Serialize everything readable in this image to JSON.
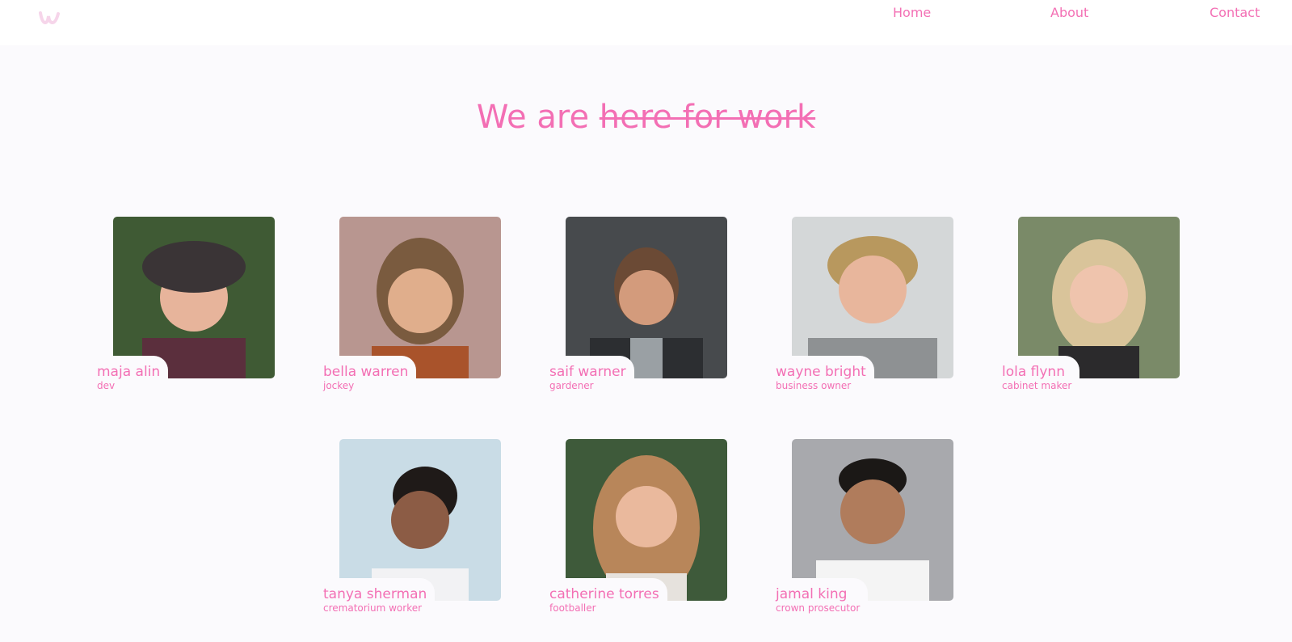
{
  "nav": {
    "logo_icon": "w-logo-icon",
    "links": [
      "Home",
      "About",
      "Contact"
    ]
  },
  "hero": {
    "prefix": "We are",
    "struck": "here for work"
  },
  "colors": {
    "accent": "#f36fb4",
    "background": "#fbfafd",
    "navbar": "#ffffff"
  },
  "people": [
    {
      "name": "maja alin",
      "role": "dev"
    },
    {
      "name": "bella warren",
      "role": "jockey"
    },
    {
      "name": "saif warner",
      "role": "gardener"
    },
    {
      "name": "wayne bright",
      "role": "business owner"
    },
    {
      "name": "lola flynn",
      "role": "cabinet maker"
    },
    {
      "name": "tanya sherman",
      "role": "crematorium worker"
    },
    {
      "name": "catherine torres",
      "role": "footballer"
    },
    {
      "name": "jamal king",
      "role": "crown prosecutor"
    }
  ]
}
